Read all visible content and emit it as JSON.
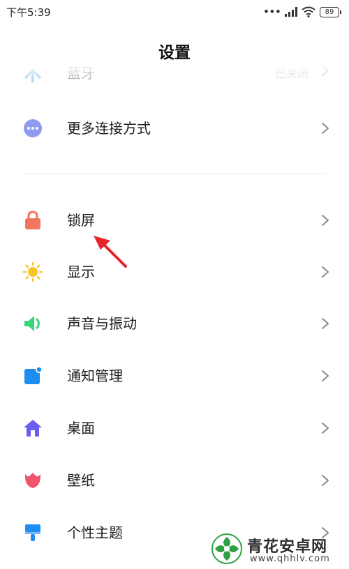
{
  "status_bar": {
    "time": "下午5:39",
    "signal_dots": "•••",
    "battery": "89"
  },
  "header": {
    "title": "设置"
  },
  "settings": {
    "items": [
      {
        "label": "蓝牙",
        "value": "已关闭",
        "icon": "bluetooth-icon",
        "color": "#1e9ef0"
      },
      {
        "label": "更多连接方式",
        "icon": "more-icon",
        "color": "#8c9cf0"
      },
      {
        "label": "锁屏",
        "icon": "lock-icon",
        "color": "#f2765e"
      },
      {
        "label": "显示",
        "icon": "sun-icon",
        "color": "#f8c42a"
      },
      {
        "label": "声音与振动",
        "icon": "speaker-icon",
        "color": "#38d47c"
      },
      {
        "label": "通知管理",
        "icon": "notification-icon",
        "color": "#1e8df0"
      },
      {
        "label": "桌面",
        "icon": "home-icon",
        "color": "#6c5cf0"
      },
      {
        "label": "壁纸",
        "icon": "tulip-icon",
        "color": "#f0556e"
      },
      {
        "label": "个性主题",
        "icon": "brush-icon",
        "color": "#1e8ff0"
      }
    ]
  },
  "watermark": {
    "title": "青花安卓网",
    "url": "www.qhhlv.com"
  },
  "colors": {
    "annotation_arrow": "#e8232a",
    "chevron": "#8a8a8a",
    "watermark_green": "#2ea043"
  }
}
